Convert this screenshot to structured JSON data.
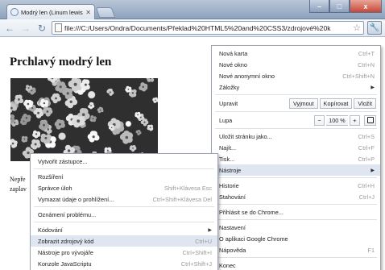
{
  "browser": {
    "tab_title": "Modrý len (Linum lewisii)",
    "url": "file:///C:/Users/Ondra/Documents/Překlad%20HTML5%20and%20CSS3/zdrojové%20k",
    "window_buttons": {
      "minimize": "–",
      "maximize": "□",
      "close": "x"
    },
    "icons": {
      "back": "back-arrow-icon",
      "forward": "forward-arrow-icon",
      "reload": "reload-icon",
      "star": "bookmark-star-icon",
      "wrench": "wrench-icon"
    }
  },
  "page": {
    "heading": "Prchlavý modrý len",
    "text_lines": [
      "Nepře",
      "zaplav"
    ]
  },
  "menu": {
    "items_top": [
      {
        "label": "Nová karta",
        "shortcut": "Ctrl+T"
      },
      {
        "label": "Nové okno",
        "shortcut": "Ctrl+N"
      },
      {
        "label": "Nové anonymní okno",
        "shortcut": "Ctrl+Shift+N"
      },
      {
        "label": "Záložky",
        "shortcut": ""
      }
    ],
    "edit": {
      "label": "Upravit",
      "cut": "Vyjmout",
      "copy": "Kopírovat",
      "paste": "Vložit"
    },
    "zoom": {
      "label": "Lupa",
      "minus": "−",
      "value": "100 %",
      "plus": "+"
    },
    "items_mid": [
      {
        "label": "Uložit stránku jako...",
        "shortcut": "Ctrl+S"
      },
      {
        "label": "Najít...",
        "shortcut": "Ctrl+F"
      },
      {
        "label": "Tisk...",
        "shortcut": "Ctrl+P"
      }
    ],
    "tools": {
      "label": "Nástroje"
    },
    "items_history": [
      {
        "label": "Historie",
        "shortcut": "Ctrl+H"
      },
      {
        "label": "Stahování",
        "shortcut": "Ctrl+J"
      }
    ],
    "signin": "Přihlásit se do Chrome...",
    "items_bottom": [
      {
        "label": "Nastavení",
        "shortcut": ""
      },
      {
        "label": "O aplikaci Google Chrome",
        "shortcut": ""
      },
      {
        "label": "Nápověda",
        "shortcut": "F1"
      }
    ],
    "exit": "Konec"
  },
  "submenu": {
    "shortcut_item": "Vytvořit zástupce...",
    "items_a": [
      {
        "label": "Rozšíření",
        "shortcut": ""
      },
      {
        "label": "Správce úloh",
        "shortcut": "Shift+Klávesa Esc"
      },
      {
        "label": "Vymazat údaje o prohlížení...",
        "shortcut": "Ctrl+Shift+Klávesa Del"
      }
    ],
    "report": "Oznámení problému...",
    "encoding": "Kódování",
    "items_b": [
      {
        "label": "Zobrazit zdrojový kód",
        "shortcut": "Ctrl+U"
      },
      {
        "label": "Nástroje pro vývojáře",
        "shortcut": "Ctrl+Shift+I"
      },
      {
        "label": "Konzole JavaScriptu",
        "shortcut": "Ctrl+Shift+J"
      }
    ]
  }
}
